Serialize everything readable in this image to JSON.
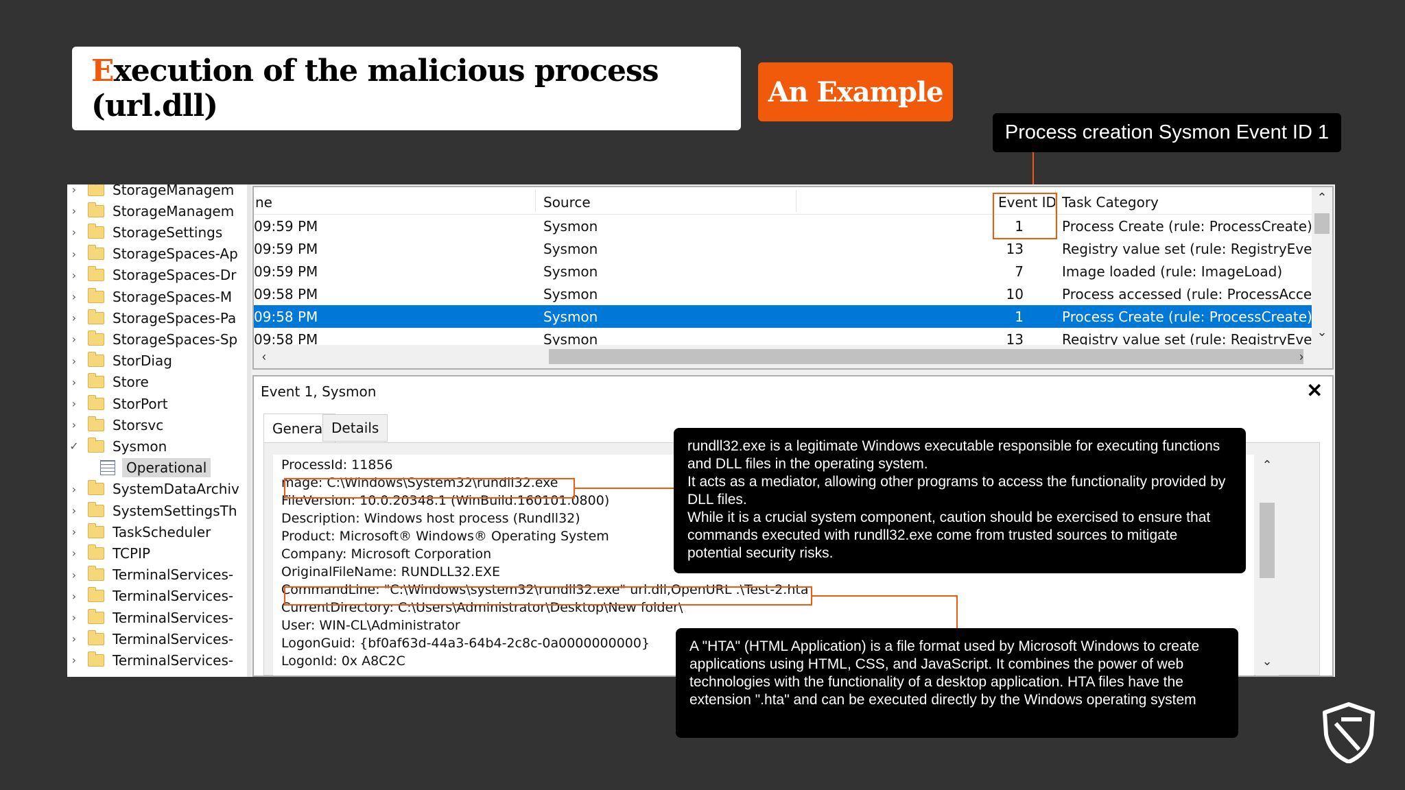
{
  "slide": {
    "title_first_letter": "E",
    "title_rest": "xecution of the malicious process (url.dll)",
    "badge": "An Example",
    "callout_top": "Process creation Sysmon Event ID 1",
    "accent_color": "#f15a0a"
  },
  "tree": {
    "items": [
      {
        "label": "StorageManagem",
        "arrow": "›",
        "icon": "folder-icon"
      },
      {
        "label": "StorageManagem",
        "arrow": "›",
        "icon": "folder-icon"
      },
      {
        "label": "StorageSettings",
        "arrow": "›",
        "icon": "folder-icon"
      },
      {
        "label": "StorageSpaces-Ap",
        "arrow": "›",
        "icon": "folder-icon"
      },
      {
        "label": "StorageSpaces-Dr",
        "arrow": "›",
        "icon": "folder-icon"
      },
      {
        "label": "StorageSpaces-M",
        "arrow": "›",
        "icon": "folder-icon"
      },
      {
        "label": "StorageSpaces-Pa",
        "arrow": "›",
        "icon": "folder-icon"
      },
      {
        "label": "StorageSpaces-Sp",
        "arrow": "›",
        "icon": "folder-icon"
      },
      {
        "label": "StorDiag",
        "arrow": "›",
        "icon": "folder-icon"
      },
      {
        "label": "Store",
        "arrow": "›",
        "icon": "folder-icon"
      },
      {
        "label": "StorPort",
        "arrow": "›",
        "icon": "folder-icon"
      },
      {
        "label": "Storsvc",
        "arrow": "›",
        "icon": "folder-icon"
      },
      {
        "label": "Sysmon",
        "arrow": "✓",
        "icon": "folder-icon"
      },
      {
        "label": "Operational",
        "arrow": "",
        "icon": "log-icon"
      },
      {
        "label": "SystemDataArchiv",
        "arrow": "›",
        "icon": "folder-icon"
      },
      {
        "label": "SystemSettingsTh",
        "arrow": "›",
        "icon": "folder-icon"
      },
      {
        "label": "TaskScheduler",
        "arrow": "›",
        "icon": "folder-icon"
      },
      {
        "label": "TCPIP",
        "arrow": "›",
        "icon": "folder-icon"
      },
      {
        "label": "TerminalServices-",
        "arrow": "›",
        "icon": "folder-icon"
      },
      {
        "label": "TerminalServices-",
        "arrow": "›",
        "icon": "folder-icon"
      },
      {
        "label": "TerminalServices-",
        "arrow": "›",
        "icon": "folder-icon"
      },
      {
        "label": "TerminalServices-",
        "arrow": "›",
        "icon": "folder-icon"
      },
      {
        "label": "TerminalServices-",
        "arrow": "›",
        "icon": "folder-icon"
      }
    ]
  },
  "grid": {
    "headers": {
      "time": "ne",
      "source": "Source",
      "event_id": "Event ID",
      "task": "Task Category"
    },
    "rows": [
      {
        "time": "09:59 PM",
        "source": "Sysmon",
        "event_id": "1",
        "task": "Process Create (rule: ProcessCreate)"
      },
      {
        "time": "09:59 PM",
        "source": "Sysmon",
        "event_id": "13",
        "task": "Registry value set (rule: RegistryEvent)"
      },
      {
        "time": "09:59 PM",
        "source": "Sysmon",
        "event_id": "7",
        "task": "Image loaded (rule: ImageLoad)"
      },
      {
        "time": "09:58 PM",
        "source": "Sysmon",
        "event_id": "10",
        "task": "Process accessed (rule: ProcessAccess)"
      },
      {
        "time": "09:58 PM",
        "source": "Sysmon",
        "event_id": "1",
        "task": "Process Create (rule: ProcessCreate)"
      },
      {
        "time": "09:58 PM",
        "source": "Sysmon",
        "event_id": "13",
        "task": "Registry value set (rule: RegistryEvent)"
      }
    ],
    "selected_index": 4
  },
  "event_panel": {
    "title": "Event 1, Sysmon",
    "tabs": [
      "General",
      "Details"
    ],
    "lines": [
      "ProcessId: 11856",
      "mage: C:\\Windows\\System32\\rundll32.exe",
      "FileVersion: 10.0.20348.1 (WinBuild.160101.0800)",
      "Description: Windows host process (Rundll32)",
      "Product: Microsoft® Windows® Operating System",
      "Company: Microsoft Corporation",
      "OriginalFileName: RUNDLL32.EXE",
      "CommandLine: \"C:\\Windows\\system32\\rundll32.exe\" url.dll,OpenURL .\\Test-2.hta",
      "CurrentDirectory: C:\\Users\\Administrator\\Desktop\\New folder\\",
      "User: WIN-CL\\Administrator",
      "LogonGuid: {bf0af63d-44a3-64b4-2c8c-0a0000000000}",
      "LogonId: 0x A8C2C"
    ]
  },
  "notes": {
    "rundll": [
      "rundll32.exe is a legitimate Windows executable responsible for executing functions and DLL files in the operating system.",
      "It acts as a mediator, allowing other programs to access the functionality provided by DLL files.",
      "While it is a crucial system component, caution should be exercised to ensure that commands executed with rundll32.exe come from trusted sources to mitigate potential security risks."
    ],
    "hta": "A \"HTA\" (HTML Application) is a file format used by Microsoft Windows to create applications using HTML, CSS, and JavaScript. It combines the power of web technologies with the functionality of a desktop application. HTA files have the extension \".hta\" and can be executed directly by the Windows operating system"
  }
}
